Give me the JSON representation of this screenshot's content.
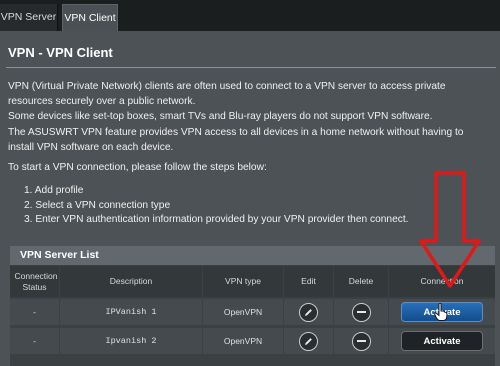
{
  "tabs": [
    {
      "label": "VPN Server"
    },
    {
      "label": "VPN Client"
    }
  ],
  "panel": {
    "title": "VPN - VPN Client",
    "description": [
      "VPN (Virtual Private Network) clients are often used to connect to a VPN server to access private resources securely over a public network.",
      "Some devices like set-top boxes, smart TVs and Blu-ray players do not support VPN software.",
      "The ASUSWRT VPN feature provides VPN access to all devices in a home network without having to install VPN software on each device."
    ],
    "steps_intro": "To start a VPN connection, please follow the steps below:",
    "steps": [
      "1. Add profile",
      "2. Select a VPN connection type",
      "3. Enter VPN authentication information provided by your VPN provider then connect."
    ]
  },
  "server_list": {
    "title": "VPN Server List",
    "columns": {
      "status": "Connection Status",
      "description": "Description",
      "type": "VPN type",
      "edit": "Edit",
      "delete": "Delete",
      "connection": "Connection"
    },
    "rows": [
      {
        "status": "-",
        "description": "IPVanish 1",
        "type": "OpenVPN",
        "action": "Activate",
        "highlighted": true
      },
      {
        "status": "-",
        "description": "Ipvanish 2",
        "type": "OpenVPN",
        "action": "Activate",
        "highlighted": false
      }
    ]
  },
  "colors": {
    "background": "#4d5256",
    "activate_highlight": "#1a5ea8",
    "annotation_arrow": "#e01818"
  }
}
